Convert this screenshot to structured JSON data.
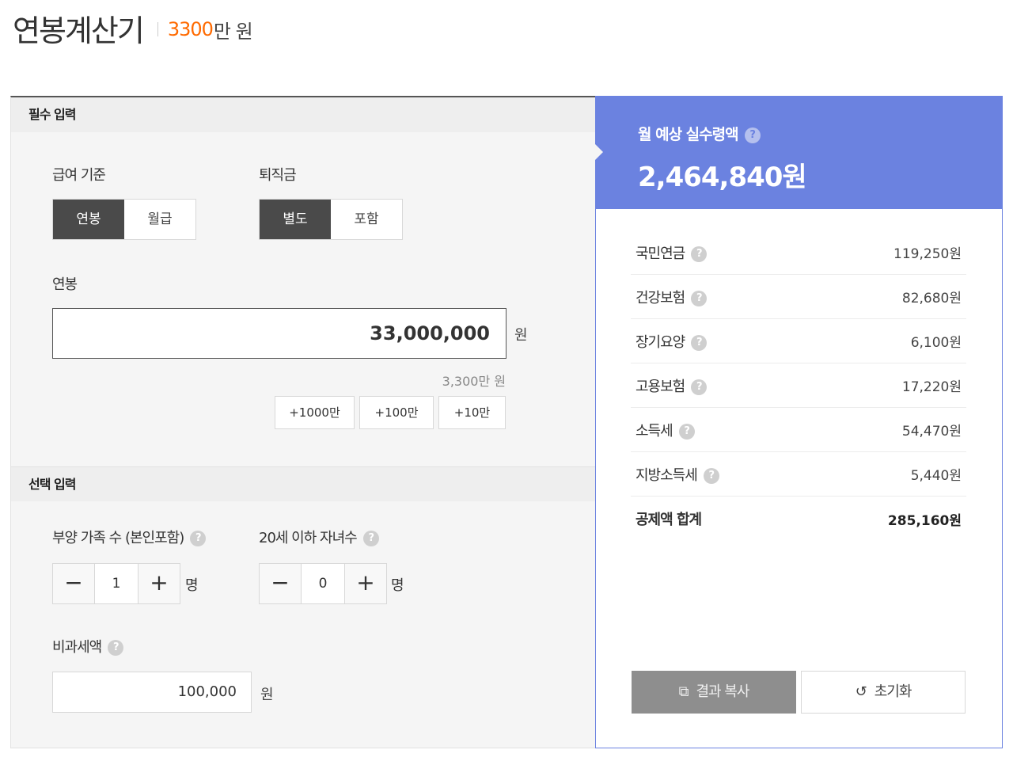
{
  "header": {
    "title": "연봉계산기",
    "amount": "3300",
    "amount_unit": "만 원"
  },
  "required": {
    "section_title": "필수 입력",
    "pay_basis": {
      "label": "급여 기준",
      "options": [
        "연봉",
        "월급"
      ],
      "selected": "연봉"
    },
    "severance": {
      "label": "퇴직금",
      "options": [
        "별도",
        "포함"
      ],
      "selected": "별도"
    },
    "salary": {
      "label": "연봉",
      "value": "33,000,000",
      "unit": "원",
      "hint": "3,300만 원"
    },
    "quick_buttons": [
      "+1000만",
      "+100만",
      "+10만"
    ]
  },
  "optional": {
    "section_title": "선택 입력",
    "dependents": {
      "label": "부양 가족 수 (본인포함)",
      "value": "1",
      "unit": "명",
      "minus": "−",
      "plus": "+"
    },
    "children": {
      "label": "20세 이하 자녀수",
      "value": "0",
      "unit": "명",
      "minus": "−",
      "plus": "+"
    },
    "nontax": {
      "label": "비과세액",
      "value": "100,000",
      "unit": "원"
    }
  },
  "result": {
    "label": "월 예상 실수령액",
    "amount": "2,464,840원",
    "deductions": [
      {
        "name": "국민연금",
        "value": "119,250원"
      },
      {
        "name": "건강보험",
        "value": "82,680원"
      },
      {
        "name": "장기요양",
        "value": "6,100원"
      },
      {
        "name": "고용보험",
        "value": "17,220원"
      },
      {
        "name": "소득세",
        "value": "54,470원"
      },
      {
        "name": "지방소득세",
        "value": "5,440원"
      }
    ],
    "total": {
      "name": "공제액 합계",
      "value": "285,160원"
    },
    "copy_button": "결과 복사",
    "reset_button": "초기화"
  },
  "help_glyph": "?",
  "colors": {
    "accent_orange": "#ff6a00",
    "result_blue": "#6b82e0",
    "active_toggle": "#4a4a4a"
  }
}
